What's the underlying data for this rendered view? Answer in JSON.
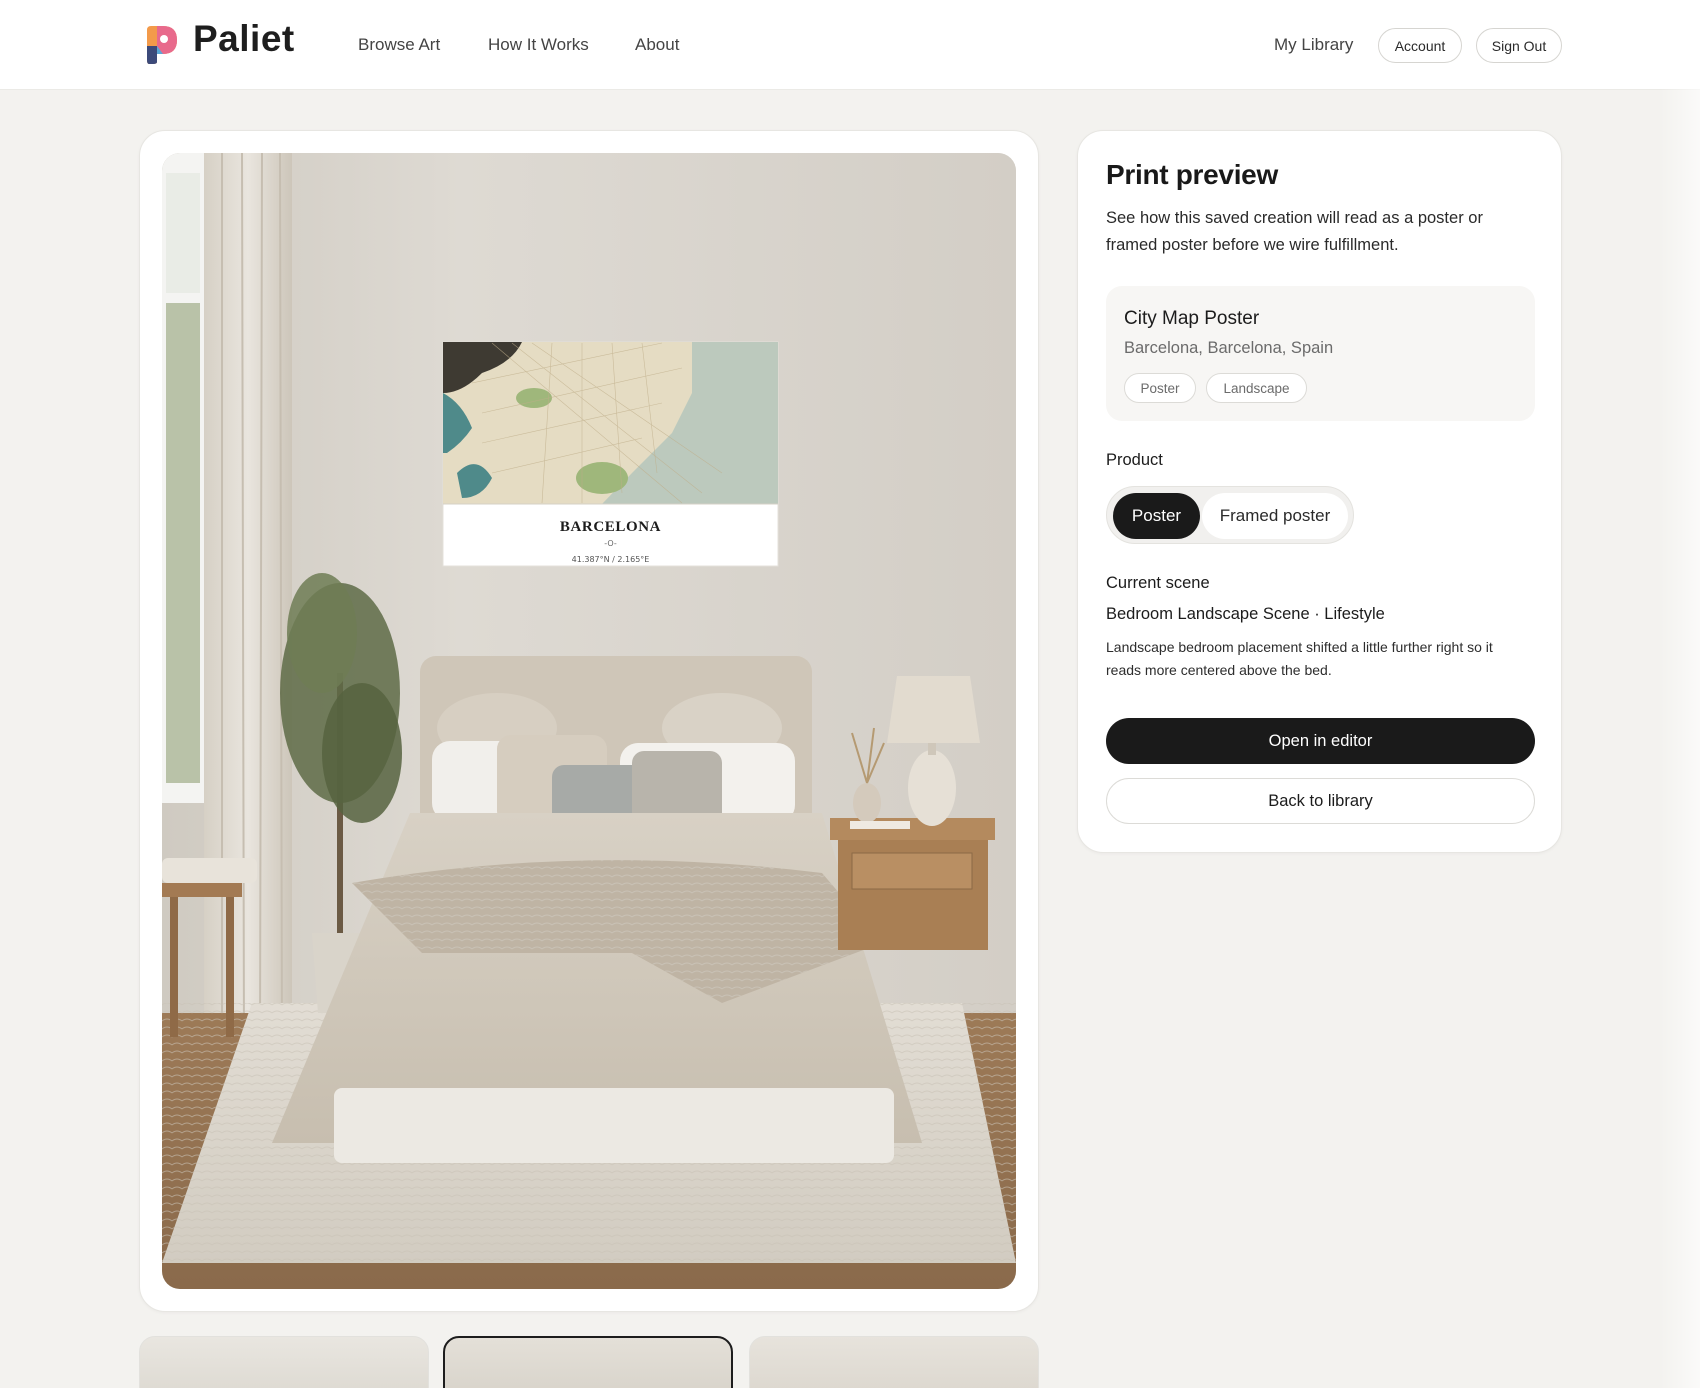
{
  "header": {
    "brand": "Paliet",
    "nav": [
      "Browse Art",
      "How It Works",
      "About"
    ],
    "library_link": "My Library",
    "account_label": "Account",
    "signout_label": "Sign Out"
  },
  "preview": {
    "poster": {
      "city": "BARCELONA",
      "divider": "-O-",
      "coordinates": "41.387°N / 2.165°E"
    }
  },
  "panel": {
    "title": "Print preview",
    "description": "See how this saved creation will read as a poster or framed poster before we wire fulfillment.",
    "item": {
      "title": "City Map Poster",
      "location": "Barcelona, Barcelona, Spain",
      "tags": [
        "Poster",
        "Landscape"
      ]
    },
    "product_label": "Product",
    "product_options": [
      "Poster",
      "Framed poster"
    ],
    "product_selected": "Poster",
    "scene_label": "Current scene",
    "scene_name": "Bedroom Landscape Scene · Lifestyle",
    "scene_note": "Landscape bedroom placement shifted a little further right so it reads more centered above the bed.",
    "primary_action": "Open in editor",
    "secondary_action": "Back to library"
  },
  "colors": {
    "page_bg": "#f3f2ef",
    "card_bg": "#ffffff",
    "accent_dark": "#1a1a1a",
    "logo_orange": "#f39a4a",
    "logo_pink": "#e86a8c",
    "logo_blue": "#5aa7d6"
  },
  "icons": {
    "logo": "paliet-logo-icon"
  }
}
